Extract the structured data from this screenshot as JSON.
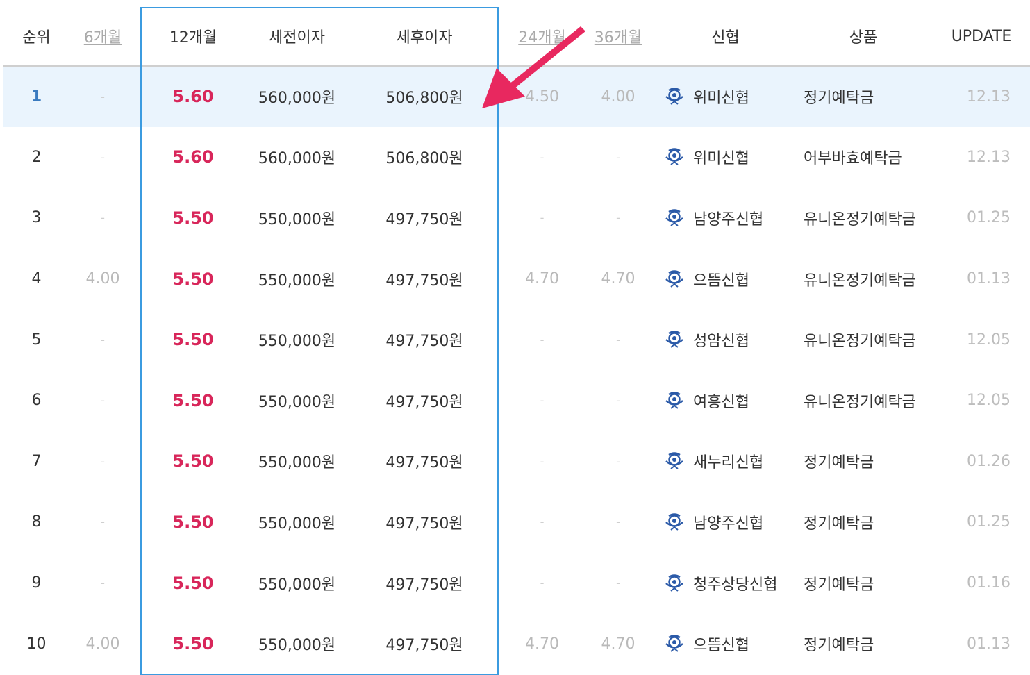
{
  "columns": {
    "rank": "순위",
    "m6": "6개월",
    "m12": "12개월",
    "pretax": "세전이자",
    "aftertax": "세후이자",
    "m24": "24개월",
    "m36": "36개월",
    "bank": "신협",
    "product": "상품",
    "update": "UPDATE"
  },
  "rows": [
    {
      "rank": "1",
      "m6": "-",
      "m12": "5.60",
      "pretax": "560,000원",
      "aftertax": "506,800원",
      "m24": "4.50",
      "m36": "4.00",
      "bank": "위미신협",
      "product": "정기예탁금",
      "update": "12.13"
    },
    {
      "rank": "2",
      "m6": "-",
      "m12": "5.60",
      "pretax": "560,000원",
      "aftertax": "506,800원",
      "m24": "-",
      "m36": "-",
      "bank": "위미신협",
      "product": "어부바효예탁금",
      "update": "12.13"
    },
    {
      "rank": "3",
      "m6": "-",
      "m12": "5.50",
      "pretax": "550,000원",
      "aftertax": "497,750원",
      "m24": "-",
      "m36": "-",
      "bank": "남양주신협",
      "product": "유니온정기예탁금",
      "update": "01.25"
    },
    {
      "rank": "4",
      "m6": "4.00",
      "m12": "5.50",
      "pretax": "550,000원",
      "aftertax": "497,750원",
      "m24": "4.70",
      "m36": "4.70",
      "bank": "으뜸신협",
      "product": "유니온정기예탁금",
      "update": "01.13"
    },
    {
      "rank": "5",
      "m6": "-",
      "m12": "5.50",
      "pretax": "550,000원",
      "aftertax": "497,750원",
      "m24": "-",
      "m36": "-",
      "bank": "성암신협",
      "product": "유니온정기예탁금",
      "update": "12.05"
    },
    {
      "rank": "6",
      "m6": "-",
      "m12": "5.50",
      "pretax": "550,000원",
      "aftertax": "497,750원",
      "m24": "-",
      "m36": "-",
      "bank": "여흥신협",
      "product": "유니온정기예탁금",
      "update": "12.05"
    },
    {
      "rank": "7",
      "m6": "-",
      "m12": "5.50",
      "pretax": "550,000원",
      "aftertax": "497,750원",
      "m24": "-",
      "m36": "-",
      "bank": "새누리신협",
      "product": "정기예탁금",
      "update": "01.26"
    },
    {
      "rank": "8",
      "m6": "-",
      "m12": "5.50",
      "pretax": "550,000원",
      "aftertax": "497,750원",
      "m24": "-",
      "m36": "-",
      "bank": "남양주신협",
      "product": "정기예탁금",
      "update": "01.25"
    },
    {
      "rank": "9",
      "m6": "-",
      "m12": "5.50",
      "pretax": "550,000원",
      "aftertax": "497,750원",
      "m24": "-",
      "m36": "-",
      "bank": "청주상당신협",
      "product": "정기예탁금",
      "update": "01.16"
    },
    {
      "rank": "10",
      "m6": "4.00",
      "m12": "5.50",
      "pretax": "550,000원",
      "aftertax": "497,750원",
      "m24": "4.70",
      "m36": "4.70",
      "bank": "으뜸신협",
      "product": "정기예탁금",
      "update": "01.13"
    }
  ],
  "colors": {
    "accent_rate": "#d8265a",
    "highlight_row": "#eaf4fd",
    "highlight_box": "#3b9be0",
    "arrow": "#e8285f",
    "logo": "#2b5aa8"
  },
  "icons": {
    "bank_logo": "credit-union-logo-icon",
    "annotation": "arrow-icon"
  }
}
